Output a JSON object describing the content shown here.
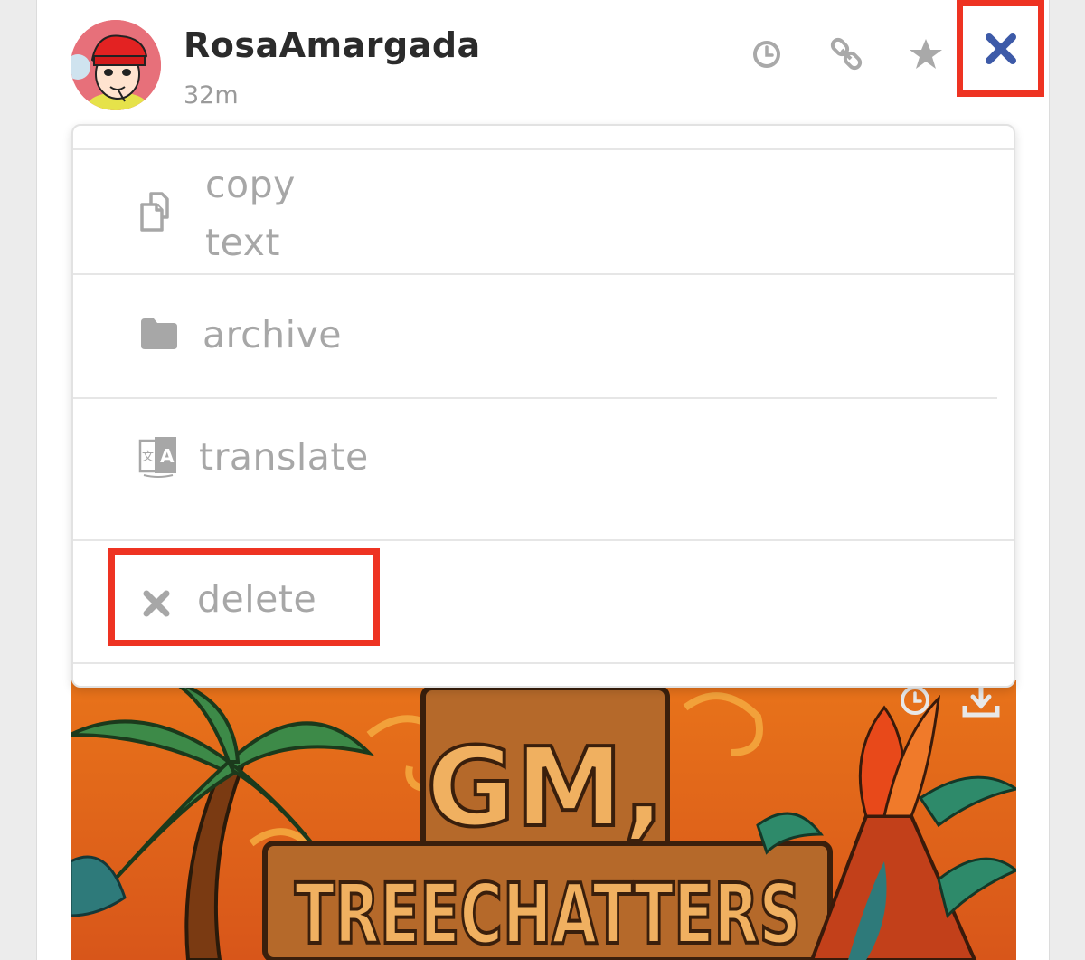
{
  "post": {
    "username": "RosaAmargada",
    "timestamp": "32m"
  },
  "header_actions": {
    "icons": [
      "clock-icon",
      "link-icon",
      "star-icon",
      "close-icon"
    ]
  },
  "menu": {
    "items": [
      {
        "label_line1": "copy",
        "label_line2": "text",
        "icon": "copy-icon"
      },
      {
        "label": "archive",
        "icon": "folder-icon"
      },
      {
        "label": "translate",
        "icon": "translate-icon"
      },
      {
        "label": "delete",
        "icon": "x-icon"
      }
    ]
  },
  "image": {
    "text_line1": "GM,",
    "text_line2": "TREECHATTERS",
    "icons": [
      "clock-icon",
      "download-icon"
    ]
  },
  "colors": {
    "highlight": "#ee3322",
    "close_icon": "#3d5aa8",
    "muted_icon": "#a7a7a7",
    "image_orange": "#e8731a"
  }
}
